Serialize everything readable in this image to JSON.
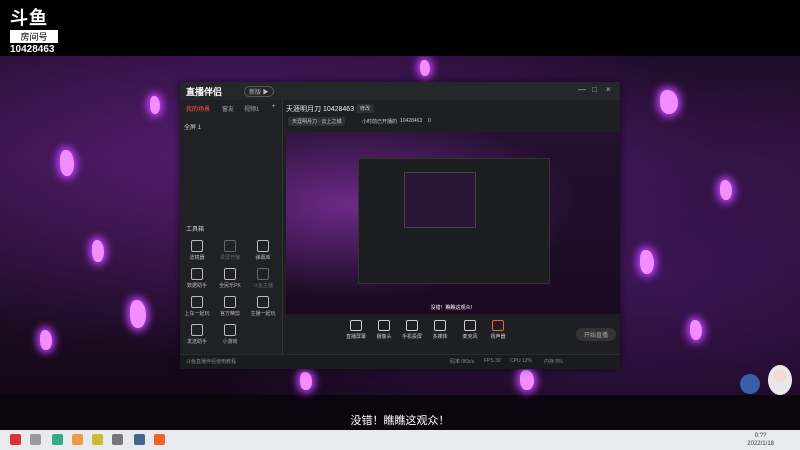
{
  "overlay": {
    "brand": "斗鱼",
    "room_label": "房间号",
    "room_number": "10428463"
  },
  "window": {
    "app_title": "直播伴侣",
    "version_badge": "新版 ▶",
    "controls": [
      "—",
      "□",
      "×"
    ]
  },
  "sidebar": {
    "tabs": [
      "我的场景",
      "窗友",
      "视频1"
    ],
    "add": "+",
    "scene_item": "全屏 1",
    "tools_title": "工具箱",
    "tools": [
      {
        "label": "滤镜器",
        "dim": false
      },
      {
        "label": "录屏开播",
        "dim": true
      },
      {
        "label": "弹幕库",
        "dim": false
      },
      {
        "label": "数据助手",
        "dim": false
      },
      {
        "label": "全民乐PK",
        "dim": false
      },
      {
        "label": "斗鱼主播",
        "dim": true
      },
      {
        "label": "上车一起玩",
        "dim": false
      },
      {
        "label": "官方精剪",
        "dim": false
      },
      {
        "label": "主播一起玩",
        "dim": false
      },
      {
        "label": "发送助手",
        "dim": false
      },
      {
        "label": "小游戏",
        "dim": false
      }
    ],
    "footer": "斗鱼直播伴侣使用教程"
  },
  "main": {
    "room_title": "天涯明月刀 10428463",
    "edit": "修改",
    "category_chip": "天涯明月刀 · 云上之城",
    "duration": "小时前已开播的",
    "room_id": "10428463",
    "heat": "0",
    "preview_caption": "没错！瞧瞧这观众！"
  },
  "bottom_toolbar": {
    "tools": [
      "直播屏幕",
      "摄像头",
      "手机投屏",
      "多媒体",
      "麦克风",
      "扬声器"
    ],
    "start_button": "开始直播"
  },
  "statusbar": {
    "left": "斗鱼直播伴侣使用教程",
    "stats": [
      "码率 0Kb/s",
      "FPS 30",
      "CPU 12%",
      "内存 5%"
    ]
  },
  "subtitle": "没错！瞧瞧这观众！",
  "taskbar": {
    "time": "0:??",
    "date": "2022/1/18"
  },
  "colors": {
    "accent": "#ff5a3c",
    "glow": "#f38cff",
    "window_bg": "#1e1f22"
  }
}
